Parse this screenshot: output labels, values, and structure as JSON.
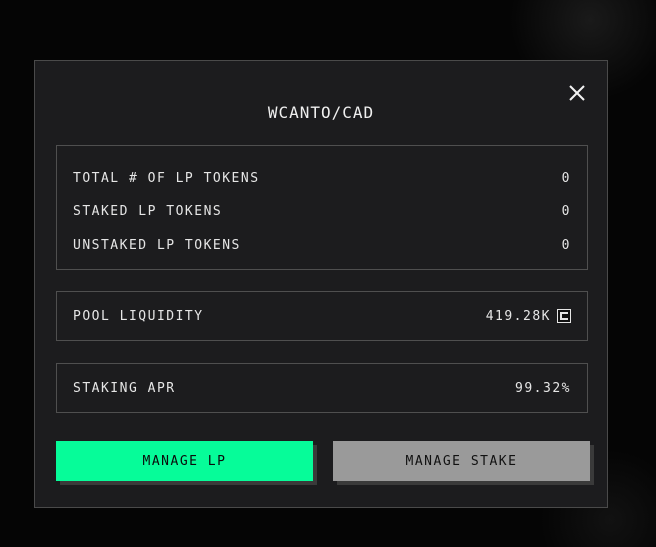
{
  "modal": {
    "title": "WCANTO/CAD",
    "close_icon": "close-icon"
  },
  "tokens": {
    "rows": [
      {
        "label": "TOTAL # OF LP TOKENS",
        "value": "0"
      },
      {
        "label": "STAKED LP TOKENS",
        "value": "0"
      },
      {
        "label": "UNSTAKED LP TOKENS",
        "value": "0"
      }
    ]
  },
  "liquidity": {
    "label": "POOL LIQUIDITY",
    "value": "419.28K",
    "icon": "canto-token-icon"
  },
  "apr": {
    "label": "STAKING APR",
    "value": "99.32%"
  },
  "buttons": {
    "manage_lp": "MANAGE LP",
    "manage_stake": "MANAGE STAKE"
  },
  "colors": {
    "background": "#050505",
    "modal_bg": "#1c1c1e",
    "border": "#4f4f4f",
    "accent": "#06fc99",
    "secondary_button": "#9a9a9a",
    "text": "#e6e6e6"
  }
}
